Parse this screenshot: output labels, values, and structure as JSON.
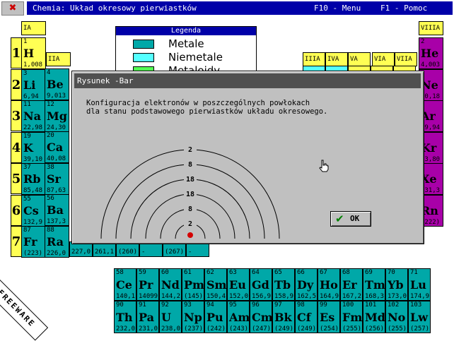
{
  "window": {
    "title": "Chemia: Układ okresowy pierwiastków",
    "menu_key": "F10 - Menu",
    "help_key": "F1 - Pomoc",
    "app_icon": "close-x-icon"
  },
  "legend": {
    "title": "Legenda",
    "items": [
      {
        "label": "Metale",
        "color": "#00a8a8"
      },
      {
        "label": "Niemetale",
        "color": "#54ffff"
      },
      {
        "label": "Metaloidy",
        "color": "#54ff54"
      }
    ]
  },
  "groups": {
    "IA": "IA",
    "IIA": "IIA",
    "IIIA": "IIIA",
    "IVA": "IVA",
    "VA": "VA",
    "VIA": "VIA",
    "VIIA": "VIIA",
    "VIIIA": "VIIIA"
  },
  "periods": [
    "1",
    "2",
    "3",
    "4",
    "5",
    "6",
    "7"
  ],
  "group1": [
    {
      "num": "1",
      "sym": "H",
      "mass": "1,008"
    },
    {
      "num": "3",
      "sym": "Li",
      "mass": "6,94"
    },
    {
      "num": "11",
      "sym": "Na",
      "mass": "22,98"
    },
    {
      "num": "19",
      "sym": "K",
      "mass": "39,10"
    },
    {
      "num": "37",
      "sym": "Rb",
      "mass": "85,48"
    },
    {
      "num": "55",
      "sym": "Cs",
      "mass": "132,9"
    },
    {
      "num": "87",
      "sym": "Fr",
      "mass": "(223)"
    }
  ],
  "group2": [
    {
      "num": "4",
      "sym": "Be",
      "mass": "9,013"
    },
    {
      "num": "12",
      "sym": "Mg",
      "mass": "24,30"
    },
    {
      "num": "20",
      "sym": "Ca",
      "mass": "40,08"
    },
    {
      "num": "38",
      "sym": "Sr",
      "mass": "87,63"
    },
    {
      "num": "56",
      "sym": "Ba",
      "mass": "137,3"
    },
    {
      "num": "88",
      "sym": "Ra",
      "mass": "226,0"
    }
  ],
  "group8": [
    {
      "num": "2",
      "sym": "He",
      "mass": "4,003"
    },
    {
      "num": "",
      "sym": "Ne",
      "mass": "20,18"
    },
    {
      "num": "",
      "sym": "Ar",
      "mass": "39,94"
    },
    {
      "num": "",
      "sym": "Kr",
      "mass": "83,80"
    },
    {
      "num": "",
      "sym": "Xe",
      "mass": "131,3"
    },
    {
      "num": "",
      "sym": "Rn",
      "mass": "(222)"
    }
  ],
  "period7_extra": [
    "227,0",
    "261,1",
    "(260)",
    "-",
    "(267)",
    "-"
  ],
  "lanthanides": [
    {
      "num": "58",
      "sym": "Ce",
      "mass": "140,1"
    },
    {
      "num": "59",
      "sym": "Pr",
      "mass": "14099"
    },
    {
      "num": "60",
      "sym": "Nd",
      "mass": "144,2"
    },
    {
      "num": "61",
      "sym": "Pm",
      "mass": "(145)"
    },
    {
      "num": "62",
      "sym": "Sm",
      "mass": "150,4"
    },
    {
      "num": "63",
      "sym": "Eu",
      "mass": "152,0"
    },
    {
      "num": "64",
      "sym": "Gd",
      "mass": "156,9"
    },
    {
      "num": "65",
      "sym": "Tb",
      "mass": "158,9"
    },
    {
      "num": "66",
      "sym": "Dy",
      "mass": "162,5"
    },
    {
      "num": "67",
      "sym": "Ho",
      "mass": "164,9"
    },
    {
      "num": "68",
      "sym": "Er",
      "mass": "167,2"
    },
    {
      "num": "69",
      "sym": "Tm",
      "mass": "168,3"
    },
    {
      "num": "70",
      "sym": "Yb",
      "mass": "173,0"
    },
    {
      "num": "71",
      "sym": "Lu",
      "mass": "174,9"
    }
  ],
  "actinides": [
    {
      "num": "90",
      "sym": "Th",
      "mass": "232,0"
    },
    {
      "num": "91",
      "sym": "Pa",
      "mass": "231,0"
    },
    {
      "num": "92",
      "sym": "U",
      "mass": "238,0"
    },
    {
      "num": "93",
      "sym": "Np",
      "mass": "(237)"
    },
    {
      "num": "94",
      "sym": "Pu",
      "mass": "(242)"
    },
    {
      "num": "95",
      "sym": "Am",
      "mass": "(243)"
    },
    {
      "num": "96",
      "sym": "Cm",
      "mass": "(247)"
    },
    {
      "num": "97",
      "sym": "Bk",
      "mass": "(249)"
    },
    {
      "num": "98",
      "sym": "Cf",
      "mass": "(249)"
    },
    {
      "num": "99",
      "sym": "Es",
      "mass": "(254)"
    },
    {
      "num": "100",
      "sym": "Fm",
      "mass": "(255)"
    },
    {
      "num": "101",
      "sym": "Md",
      "mass": "(256)"
    },
    {
      "num": "102",
      "sym": "No",
      "mass": "(255)"
    },
    {
      "num": "103",
      "sym": "Lw",
      "mass": "(257)"
    }
  ],
  "dialog": {
    "title": "Rysunek -Bar",
    "line1": "Konfiguracja elektronów w poszczególnych powłokach",
    "line2": "dla stanu podstawowego pierwiastków układu okresowego.",
    "shells": [
      "2",
      "8",
      "18",
      "18",
      "8",
      "2"
    ],
    "ok_label": "OK"
  },
  "watermark": "FREEWARE"
}
